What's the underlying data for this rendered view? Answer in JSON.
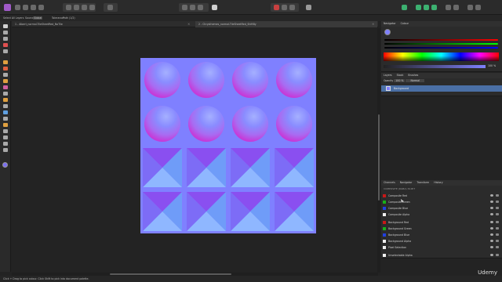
{
  "context_bar": {
    "select_label": "Select All Layers",
    "source_label": "Source",
    "source_value": "Global",
    "tolerance_label": "Tolerance",
    "tolerance_value": "Path (1/2)"
  },
  "tabs": [
    {
      "label": "1 - Albert_normal-TileSheetRed_NoTile",
      "active": false
    },
    {
      "label": "2 - Chrysthemes_normal-TileSheetRed_ShiftBy",
      "active": true
    }
  ],
  "tab_close": "×",
  "panels": {
    "color": {
      "tabs": [
        "Navigator",
        "Colour"
      ],
      "opacity_value": "100 %"
    },
    "layers": {
      "tabs": [
        "Layers",
        "Stock",
        "Brushes"
      ],
      "blend_label": "Opacity",
      "blend_value": "100 %",
      "mode_value": "Normal",
      "layer_name": "Background"
    },
    "channels": {
      "tabs": [
        "Channels",
        "Navigator",
        "Transform",
        "History"
      ],
      "header": "COMPOSITE (RGBA) 32-BIT",
      "rows": [
        {
          "label": "Composite Red",
          "color": "#c81818"
        },
        {
          "label": "Composite Green",
          "color": "#18b018"
        },
        {
          "label": "Composite Blue",
          "color": "#2040e0"
        },
        {
          "label": "Composite Alpha",
          "color": "#f0f0f0"
        },
        {
          "label": "Background Red",
          "color": "#c81818"
        },
        {
          "label": "Background Green",
          "color": "#18b018"
        },
        {
          "label": "Background Blue",
          "color": "#2040e0"
        },
        {
          "label": "Background Alpha",
          "color": "#f0f0f0"
        },
        {
          "label": "Pixel Selection",
          "color": "#f0f0f0"
        },
        {
          "label": "Unselectable Alpha",
          "color": "#f0f0f0"
        }
      ]
    }
  },
  "status": {
    "text": "Click + Drag to pick colour. Click Shift to pick into document palette."
  },
  "watermark": "Udemy"
}
